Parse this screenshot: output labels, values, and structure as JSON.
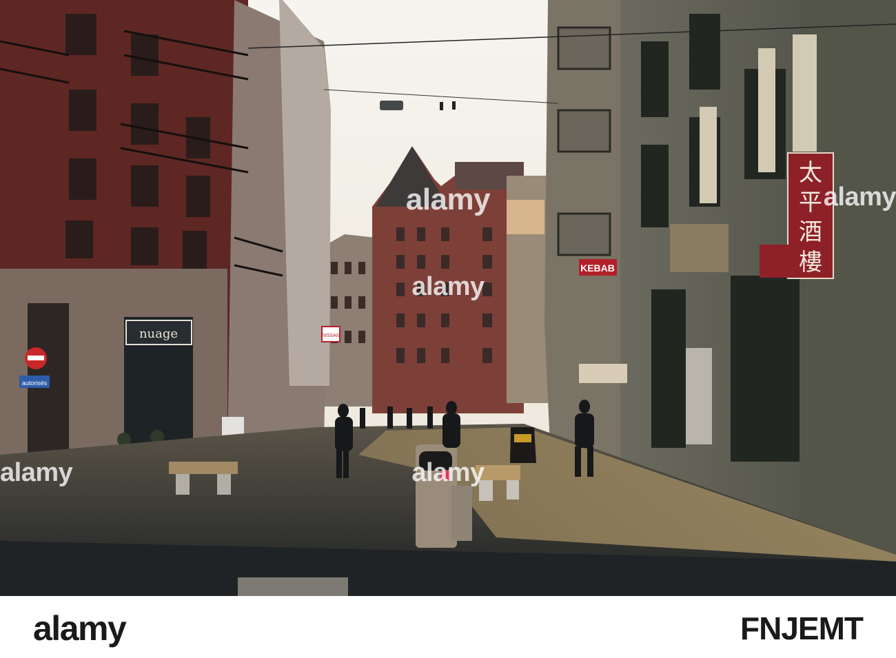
{
  "photo": {
    "signs": {
      "kebab": "KEBAB",
      "nissan": "NISSAN",
      "shop_nuage": "nuage",
      "chinese": [
        "太",
        "平",
        "酒",
        "樓"
      ],
      "autorises": "autorisés"
    }
  },
  "watermark": {
    "text": "alamy"
  },
  "footer": {
    "logo": "alamy",
    "image_id": "FNJEMT"
  },
  "colors": {
    "sky": "#f3f0e8",
    "shadow": "#262a2c",
    "sunlit_cobble": "#8a7a5a",
    "red_facade": "#6e2a26",
    "sign_red": "#b3202a"
  }
}
